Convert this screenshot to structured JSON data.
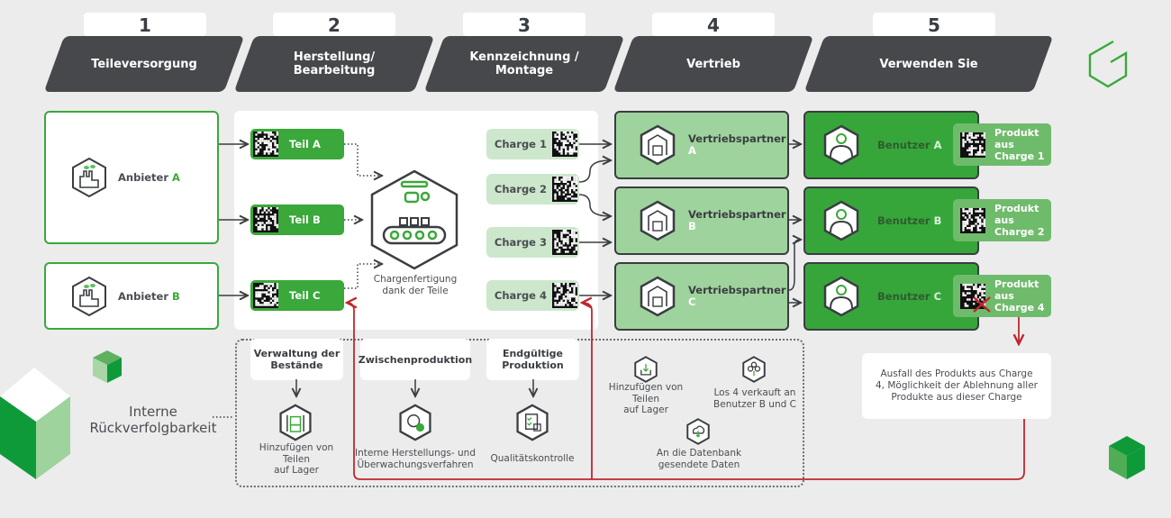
{
  "stages": [
    {
      "number": "1",
      "label": "Teileversorgung"
    },
    {
      "number": "2",
      "label": "Herstellung/\nBearbeitung"
    },
    {
      "number": "3",
      "label": "Kennzeichnung /\nMontage"
    },
    {
      "number": "4",
      "label": "Vertrieb"
    },
    {
      "number": "5",
      "label": "Verwenden Sie"
    }
  ],
  "suppliers": [
    {
      "name": "Anbieter",
      "letter": "A",
      "icon": "factory-icon"
    },
    {
      "name": "Anbieter",
      "letter": "B",
      "icon": "factory-icon"
    }
  ],
  "parts": [
    {
      "label": "Teil A"
    },
    {
      "label": "Teil B"
    },
    {
      "label": "Teil C"
    }
  ],
  "batch_production": {
    "icon": "conveyor-robot-icon",
    "caption": "Chargenfertigung\ndank der Teile"
  },
  "batches": [
    {
      "label": "Charge 1"
    },
    {
      "label": "Charge 2"
    },
    {
      "label": "Charge 3"
    },
    {
      "label": "Charge 4"
    }
  ],
  "distributors": [
    {
      "name": "Vertriebspartner",
      "letter": "A",
      "icon": "warehouse-icon"
    },
    {
      "name": "Vertriebspartner",
      "letter": "B",
      "icon": "warehouse-icon"
    },
    {
      "name": "Vertriebspartner",
      "letter": "C",
      "icon": "warehouse-icon"
    }
  ],
  "users": [
    {
      "name": "Benutzer",
      "letter": "A",
      "icon": "user-icon",
      "product": "Produkt\naus\nCharge 1",
      "defective": false
    },
    {
      "name": "Benutzer",
      "letter": "B",
      "icon": "user-icon",
      "product": "Produkt\naus\nCharge 2",
      "defective": false
    },
    {
      "name": "Benutzer",
      "letter": "C",
      "icon": "user-icon",
      "product": "Produkt\naus\nCharge 4",
      "defective": true
    }
  ],
  "failure_note": "Ausfall des Produkts aus Charge 4, Möglichkeit der Ablehnung aller Produkte aus dieser Charge",
  "internal": {
    "label": "Interne\nRückverfolgbarkeit",
    "steps": [
      {
        "heading": "Verwaltung der\nBestände",
        "icon": "inventory-shelf-icon",
        "caption": "Hinzufügen von\nTeilen\nauf Lager"
      },
      {
        "heading": "Zwischenproduktion",
        "icon": "gear-wrench-check-icon",
        "caption": "Interne Herstellungs- und\nÜberwachungsverfahren"
      },
      {
        "heading": "Endgültige\nProduktion",
        "icon": "clipboard-check-icon",
        "caption": "Qualitätskontrolle"
      }
    ],
    "distribution_notes": [
      {
        "icon": "tray-download-icon",
        "caption": "Hinzufügen von\nTeilen\nauf Lager"
      },
      {
        "icon": "boxes-tree-icon",
        "caption": "Los 4 verkauft an\nBenutzer B und C"
      },
      {
        "icon": "cloud-download-icon",
        "caption": "An die Datenbank\ngesendete Daten"
      }
    ]
  },
  "colors": {
    "green": "#3aa83a",
    "light_green": "#9fd39d",
    "pale_green": "#cde7cc",
    "dark": "#46484b",
    "red": "#c0262d",
    "background": "#ececec"
  }
}
